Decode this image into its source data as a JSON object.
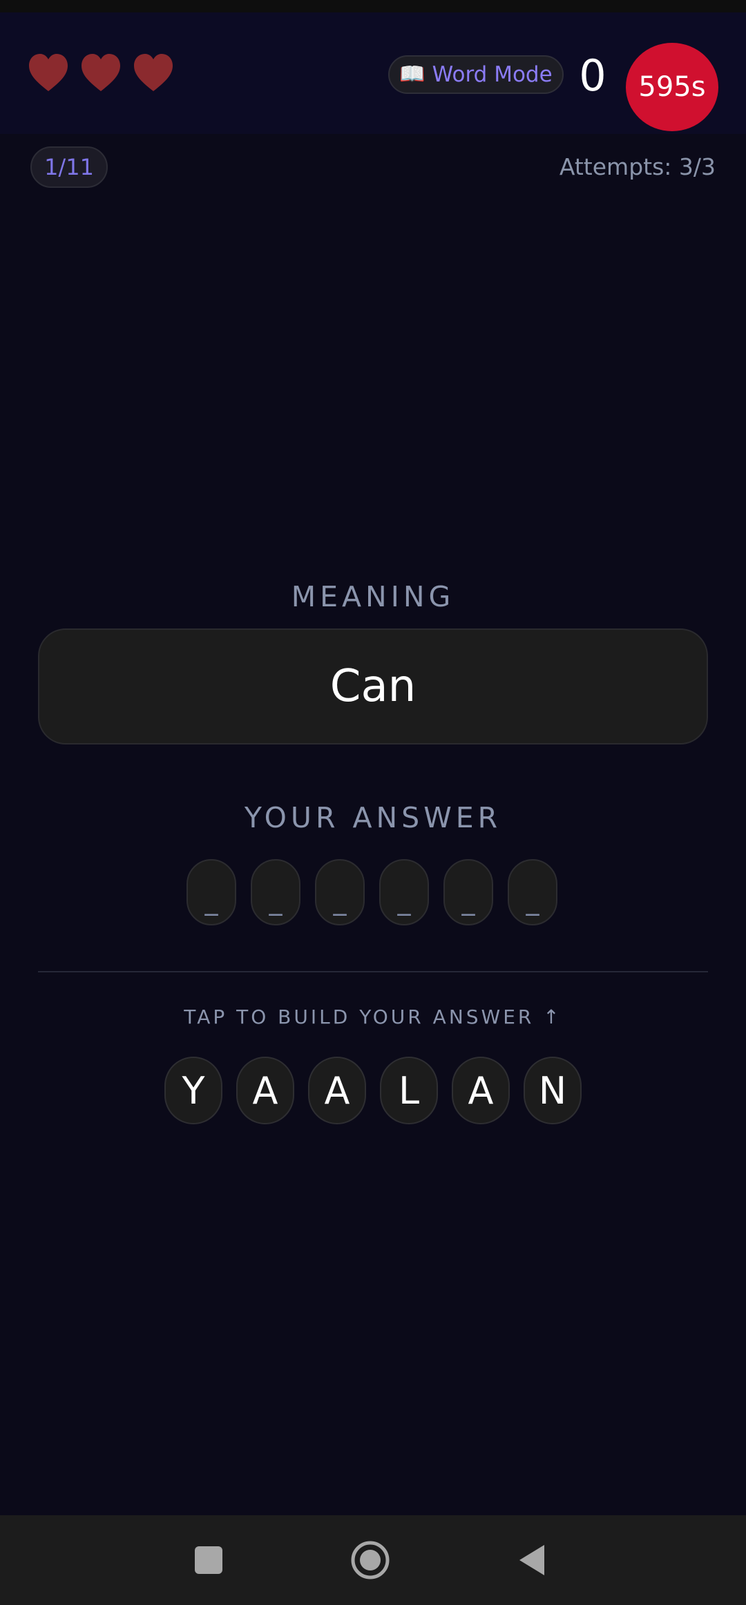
{
  "header": {
    "lives": [
      {
        "icon": "heart-icon",
        "color": "#8b2a2e"
      },
      {
        "icon": "heart-icon",
        "color": "#8b2a2e"
      },
      {
        "icon": "heart-icon",
        "color": "#8b2a2e"
      }
    ],
    "mode_icon": "open-book-icon",
    "mode_glyph": "📖",
    "mode_label": "Word Mode",
    "score": "0",
    "timer": "595s",
    "timer_color": "#d0102f"
  },
  "progress": {
    "counter": "1/11",
    "attempts": "Attempts: 3/3"
  },
  "meaning": {
    "label": "MEANING",
    "word": "Can"
  },
  "answer": {
    "label": "YOUR ANSWER",
    "slots": [
      "_",
      "_",
      "_",
      "_",
      "_",
      "_"
    ]
  },
  "letter_pool": {
    "hint": "TAP TO BUILD YOUR ANSWER ↑",
    "letters": [
      "Y",
      "A",
      "A",
      "L",
      "A",
      "N"
    ]
  },
  "navbar": {
    "recents_icon": "square-recents-icon",
    "home_icon": "circle-home-icon",
    "back_icon": "triangle-back-icon"
  },
  "colors": {
    "background": "#0b0a19",
    "header_background": "#0c0b24",
    "accent": "#8b7cf6",
    "muted_text": "#8b95ad"
  }
}
